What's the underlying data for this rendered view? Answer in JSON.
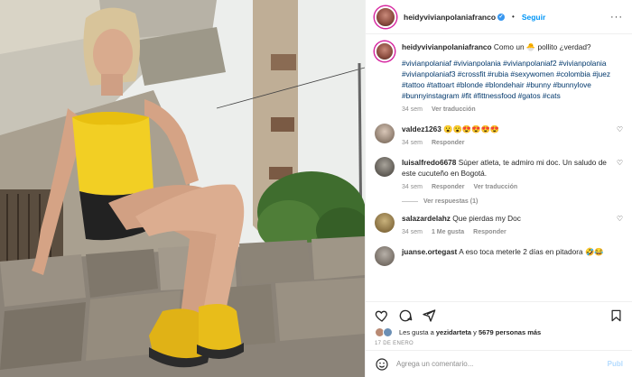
{
  "header": {
    "username": "heidyvivianpolaniafranco",
    "separator": "•",
    "follow_label": "Seguir",
    "more_glyph": "···"
  },
  "caption": {
    "username": "heidyvivianpolaniafranco",
    "text": "Como un 🐣 pollito ¿verdad?",
    "hashtags": "#vivianpolaniaf #vivianpolania #vivianpolaniaf2 #vivianpolania #vivianpolaniaf3 #crossfit #rubia #sexywomen #colombia #juez #tattoo #tattoart #blonde #blondehair #bunny #bunnylove #bunnyinstagram #fit #fittnessfood #gatos #cats",
    "time": "34 sem",
    "translate": "Ver traducción"
  },
  "comments": [
    {
      "user": "valdez1263",
      "text": "😮😮😍😍😍😍",
      "time": "34 sem",
      "likes": "",
      "reply": "Responder",
      "translate": ""
    },
    {
      "user": "luisalfredo6678",
      "text": "Súper atleta, te admiro mi doc. Un saludo de este cucuteño en Bogotá.",
      "time": "34 sem",
      "likes": "",
      "reply": "Responder",
      "translate": "Ver traducción"
    },
    {
      "user": "salazardelahz",
      "text": "Que pierdas my Doc",
      "time": "34 sem",
      "likes": "1 Me gusta",
      "reply": "Responder",
      "translate": ""
    },
    {
      "user": "juanse.ortegast",
      "text": "A eso toca meterle 2 días en pitadora 🤣😂",
      "time": "",
      "likes": "",
      "reply": "",
      "translate": ""
    }
  ],
  "replies_label": "Ver respuestas (1)",
  "likes": {
    "prefix": "Les gusta a",
    "user": "yezidarteta",
    "conj": "y",
    "count": "5679 personas más"
  },
  "date": "17 DE ENERO",
  "add_comment": {
    "placeholder": "Agrega un comentario...",
    "publish": "Publ"
  },
  "icons": {
    "heart": "heart-icon",
    "comment": "comment-icon",
    "share": "share-icon",
    "bookmark": "bookmark-icon",
    "emoji": "emoji-icon"
  },
  "colors": {
    "accent": "#0095f6",
    "link": "#00376b",
    "muted": "#8e8e8e"
  }
}
